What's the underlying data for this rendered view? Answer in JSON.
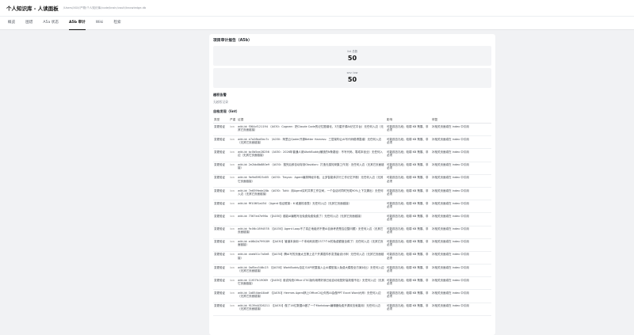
{
  "header": {
    "title": "个人知识库 - 人读面板",
    "path": "/Users/XXX/产物/个人知识库/code/brain/vault/knowledge.db"
  },
  "tabs": [
    {
      "label": "概览"
    },
    {
      "label": "图谱"
    },
    {
      "label": "A5a 状态"
    },
    {
      "label": "A5b 审计"
    },
    {
      "label": "Wiki"
    },
    {
      "label": "检索"
    }
  ],
  "report": {
    "title": "项目审计报告（A5b）",
    "stats": [
      {
        "label": "lint 总数",
        "value": "50"
      },
      {
        "label": "sev: low",
        "value": "50"
      }
    ],
    "violations_title": "越权告警",
    "violations_empty": "无越权记录",
    "findings_title": "自检发现（lint）",
    "columns": [
      "类型",
      "严重",
      "证据",
      "影响",
      "修复"
    ],
    "rows": [
      {
        "type": "变更验证",
        "sev": "low",
        "evidence": "wiki-id: f364cf121194 （A030：Cognee：把Claude Code的记忆图谱化，3万星开源AI记忆平台）无任何入边（无其它页面链接）",
        "impact": "可能孤岛孔段；较弱 KB 策展、非必须",
        "fix": "补相关页面或在 index 中引用"
      },
      {
        "type": "变更验证",
        "sev": "low",
        "evidence": "wiki-id: e7a28bd3ec7c （A030：阿里云Qoder开源Better Harness：三层架构让AI写代码稳得靠谱）无任何入边（无其它页面链接）",
        "impact": "可能孤岛孔段；较弱 KB 策展、非必须",
        "fix": "补相关页面或在 index 中引用"
      },
      {
        "type": "变更验证",
        "sev": "low",
        "evidence": "wiki-id: bc0b5ae28256 （A030：2026年普通人用WorkBuddy赚钱的N条路径：不写代码、零成本创业）无任何入边（无其它页面链接）",
        "impact": "可能孤岛孔段；较弱 KB 策展、非必须",
        "fix": "补相关页面或在 index 中引用"
      },
      {
        "type": "变更验证",
        "sev": "low",
        "evidence": "wiki-id: 2e2bb8b880e9 （A030：搜完后即自动存到Obsidian：打造无感知采集工作流）无任何入边（无其它页面链接）",
        "impact": "可能孤岛孔段；较弱 KB 策展、非必须",
        "fix": "补相关页面或在 index 中引用"
      },
      {
        "type": "变更验证",
        "sev": "low",
        "evidence": "wiki-id: 9e9e89f23d05 （A030：Trayon：Agent编排神经中枢，让多智能体并行工作记忆不断）无任何入边（无其它页面链接）",
        "impact": "可能孤岛孔段；较弱 KB 策展、非必须",
        "fix": "补相关页面或在 index 中引用"
      },
      {
        "type": "变更验证",
        "sev": "low",
        "evidence": "wiki-id: 7e659fede28b （A030：Tutti：用Agent实时共享工作空间，一个会话可同时完成90%上下文漏出）无任何入边（无其它页面链接）",
        "impact": "可能孤岛孔段；较弱 KB 策展、非必须",
        "fix": "补相关页面或在 index 中引用"
      },
      {
        "type": "变更验证",
        "sev": "low",
        "evidence": "wiki-id: fff106f1a454 （Agent 验证框架：6 维度校准表）无任何入边（无其它页面链接）",
        "impact": "可能孤岛孔段；较弱 KB 策展、非必须",
        "fix": "补相关页面或在 index 中引用"
      },
      {
        "type": "变更验证",
        "sev": "low",
        "evidence": "wiki-id: 7367ed7e96a （【A030】谁能AI编程写出免费免费免费了）无任何入边（无其它页面链接）",
        "impact": "可能孤岛孔段；较弱 KB 策展、非必须",
        "fix": "补相关页面或在 index 中引用"
      },
      {
        "type": "变更验证",
        "sev": "low",
        "evidence": "wiki-id: 9c06c1894578 （【A030】Agent Loop不了真正地组织不是AI自身考虑是否应整问题）无任何入边（无其它页面链接）",
        "impact": "可能孤岛孔段；较弱 KB 策展、非必须",
        "fix": "补相关页面或在 index 中引用"
      },
      {
        "type": "变更验证",
        "sev": "low",
        "evidence": "wiki-id: e46b2b799189 （【A030】管道本身用一个本地利用把2377个AI的免费额度全薅了）无任何入边（无其它页面链接）",
        "impact": "可能孤岛孔段；较弱 KB 策展、非必须",
        "fix": "补相关页面或在 index 中引用"
      },
      {
        "type": "变更验证",
        "sev": "low",
        "evidence": "wiki-id: cbeb51c7a0e8 （【A030】腾AI写的页面太丑第上这个开源插件秒变顶级设计师）无任何入边（无其它页面链接）",
        "impact": "可能孤岛孔段；较弱 KB 策展、非必须",
        "fix": "补相关页面或在 index 中引用"
      },
      {
        "type": "变更验证",
        "sev": "low",
        "evidence": "wiki-id: 0af5ec546c23 （【A030】WorkBuddy自定义API完整接入让AI模型接入免费大模型全方案对比）无任何入边（无其它页面链接）",
        "impact": "可能孤岛孔段；较弱 KB 策展、非必须",
        "fix": "补相关页面或在 index 中引用"
      },
      {
        "type": "变更验证",
        "sev": "low",
        "evidence": "wiki-id: 11f07fc19069 （【A030】谁说传统Office LTSC版你用得好我已经自动化配好高效做不出）无任何入边（无其它页面链接）",
        "impact": "可能孤岛孔段；较弱 KB 策展、非必须",
        "fix": "补相关页面或在 index 中引用"
      },
      {
        "type": "变更验证",
        "sev": "low",
        "evidence": "wiki-id: 1b854be44bdf （【A030】Hermes Agent搞上OfficeCli让你的AI会做PPT Excel Word大师）无任何入边（无其它页面链接）",
        "impact": "可能孤岛孔段；较弱 KB 策展、非必须",
        "fix": "补相关页面或在 index 中引用"
      },
      {
        "type": "变更验证",
        "sev": "low",
        "evidence": "wiki-id: 9139d4326211 （【A030】做了16亿数据AI做了一个Markdown编辑器免费开源双击就能用）无任何入边（无其它页面链接）",
        "impact": "可能孤岛孔段；较弱 KB 策展、非必须",
        "fix": "补相关页面或在 index 中引用"
      }
    ]
  }
}
